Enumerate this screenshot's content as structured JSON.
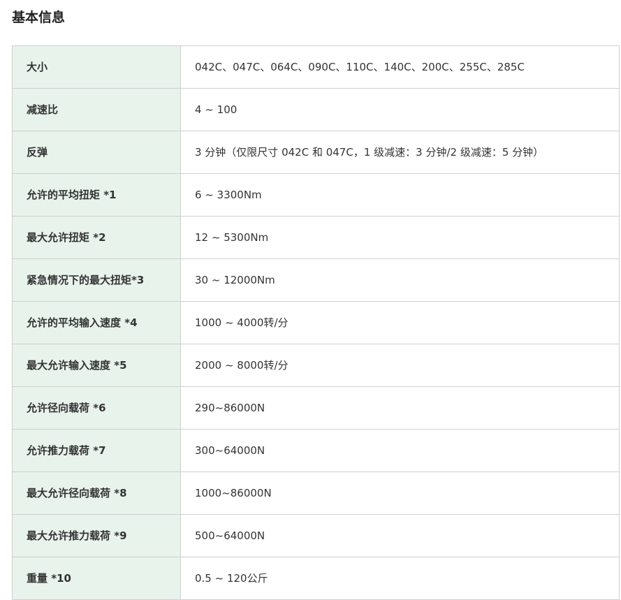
{
  "page": {
    "title": "基本信息"
  },
  "spec_table": {
    "rows": [
      {
        "label": "大小",
        "value": "042C、047C、064C、090C、110C、140C、200C、255C、285C"
      },
      {
        "label": "减速比",
        "value": "4 ~ 100"
      },
      {
        "label": "反弹",
        "value": "3 分钟（仅限尺寸 042C 和 047C，1 级减速：3 分钟/2 级减速：5 分钟）"
      },
      {
        "label": "允许的平均扭矩 *1",
        "value": "6 ~ 3300Nm"
      },
      {
        "label": "最大允许扭矩 *2",
        "value": "12 ~ 5300Nm"
      },
      {
        "label": "紧急情况下的最大扭矩*3",
        "value": "30 ~ 12000Nm"
      },
      {
        "label": "允许的平均输入速度 *4",
        "value": "1000 ~ 4000转/分"
      },
      {
        "label": "最大允许输入速度 *5",
        "value": "2000 ~ 8000转/分"
      },
      {
        "label": "允许径向载荷 *6",
        "value": "290~86000N"
      },
      {
        "label": "允许推力载荷 *7",
        "value": "300~64000N"
      },
      {
        "label": "最大允许径向载荷 *8",
        "value": "1000~86000N"
      },
      {
        "label": "最大允许推力载荷 *9",
        "value": "500~64000N"
      },
      {
        "label": "重量 *10",
        "value": "0.5 ~ 120公斤"
      }
    ]
  },
  "colors": {
    "label_background": "#e8f3ec",
    "border": "#cfcfcf",
    "text": "#333333"
  }
}
